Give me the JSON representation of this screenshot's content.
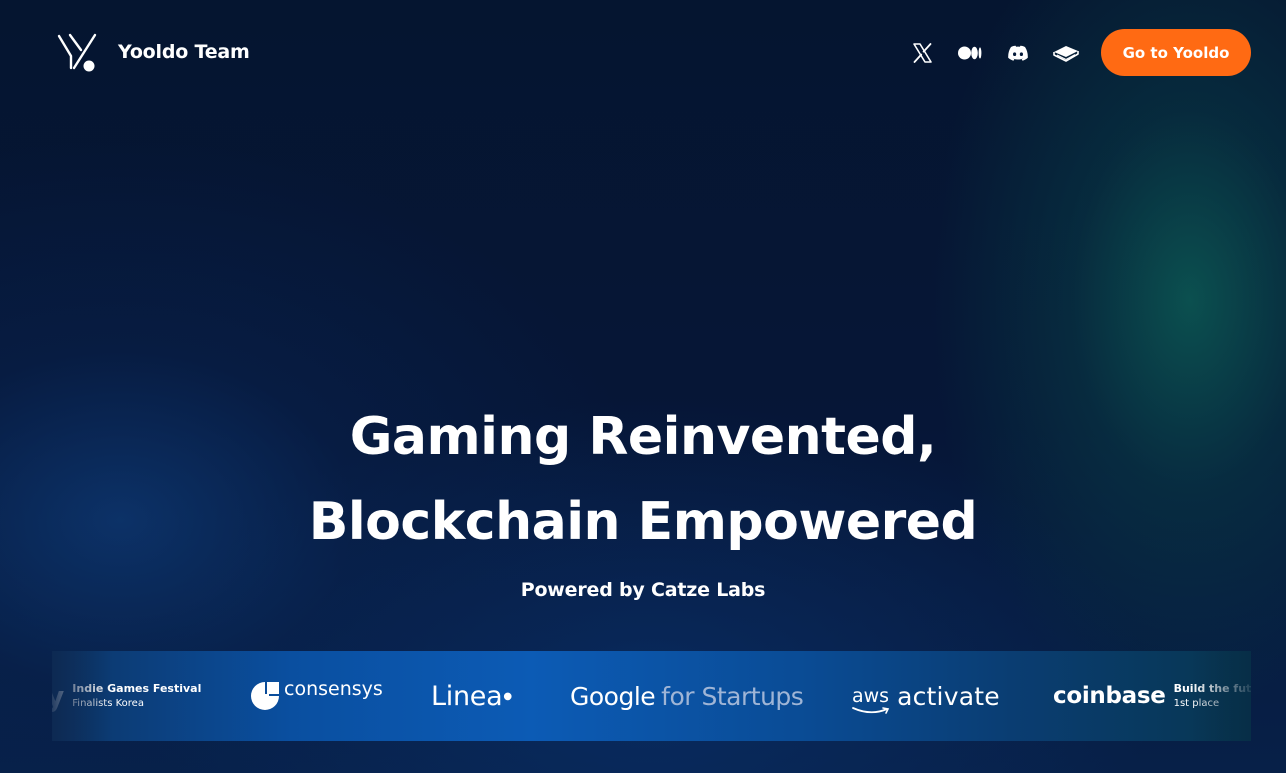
{
  "nav": {
    "brand": "Yooldo Team",
    "logo_icon": "yooldo-logo-icon",
    "social_icons": [
      "x-icon",
      "medium-icon",
      "discord-icon",
      "book-icon"
    ],
    "cta_label": "Go to Yooldo",
    "cta_color": "#ff6a13"
  },
  "hero": {
    "title_line1": "Gaming Reinvented,",
    "title_line2": "Blockchain Empowered",
    "subtitle": "Powered by Catze Labs"
  },
  "partners": {
    "indie": {
      "mark": "y",
      "line1": "Indie Games Festival",
      "line2": "Finalists Korea"
    },
    "consensys": {
      "name": "consensys"
    },
    "linea": {
      "name": "Linea"
    },
    "google": {
      "part1": "Google",
      "part2": "for Startups"
    },
    "aws": {
      "part1": "aws",
      "part2": "activate"
    },
    "coinbase": {
      "name": "coinbase",
      "line1": "Build the futu",
      "line2": "1st place"
    }
  },
  "colors": {
    "background": "#05132f",
    "accent": "#ff6a13",
    "teal_glow": "#0c5a54",
    "strip_blue": "#0c5bb5"
  }
}
